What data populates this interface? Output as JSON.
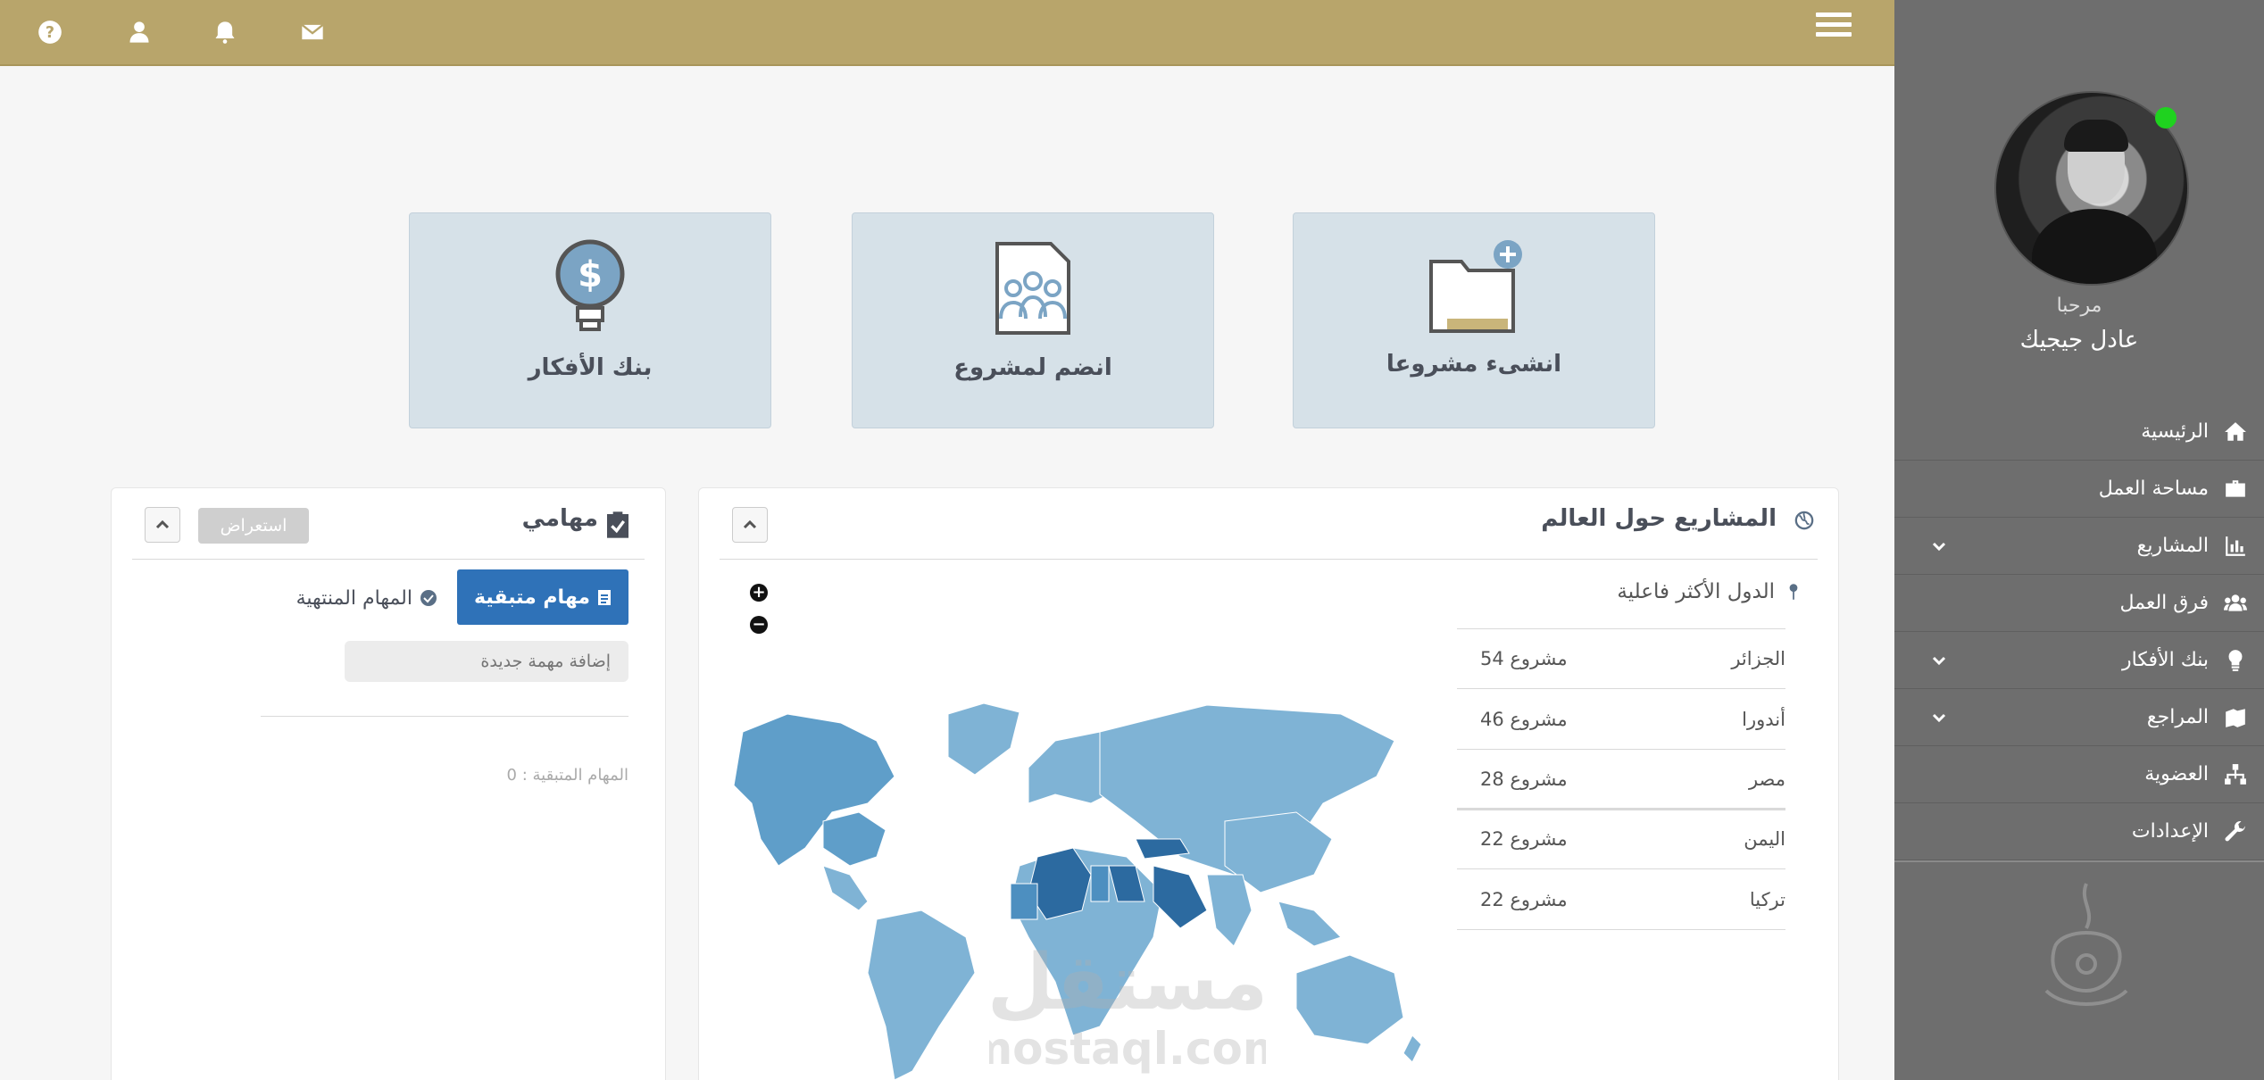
{
  "topbar": {
    "icons": [
      "help-icon",
      "user-icon",
      "bell-icon",
      "envelope-icon"
    ],
    "menu_icon": "hamburger-icon",
    "color": "#b8a56b"
  },
  "sidebar": {
    "greeting": "مرحبا",
    "username": "عادل جيجيك",
    "online_color": "#1fd21f",
    "items": [
      {
        "label": "الرئيسية",
        "icon": "home-icon",
        "has_submenu": false
      },
      {
        "label": "مساحة العمل",
        "icon": "briefcase-icon",
        "has_submenu": false
      },
      {
        "label": "المشاريع",
        "icon": "chart-icon",
        "has_submenu": true
      },
      {
        "label": "فرق العمل",
        "icon": "users-icon",
        "has_submenu": false
      },
      {
        "label": "بنك الأفكار",
        "icon": "lightbulb-icon",
        "has_submenu": true
      },
      {
        "label": "المراجع",
        "icon": "books-icon",
        "has_submenu": true
      },
      {
        "label": "العضوية",
        "icon": "sitemap-icon",
        "has_submenu": false
      },
      {
        "label": "الإعدادات",
        "icon": "wrench-icon",
        "has_submenu": false
      }
    ]
  },
  "cards": {
    "create": "انشىء مشروعا",
    "join": "انضم لمشروع",
    "ideas": "بنك الأفكار"
  },
  "projects_panel": {
    "title": "المشاريع حول العالم",
    "top_countries_title": "الدول الأكثر فاعلية",
    "countries": [
      {
        "name": "الجزائر",
        "count": "54 مشروع"
      },
      {
        "name": "أندورا",
        "count": "46 مشروع"
      },
      {
        "name": "مصر",
        "count": "28 مشروع"
      },
      {
        "name": "اليمن",
        "count": "22 مشروع"
      },
      {
        "name": "تركيا",
        "count": "22 مشروع"
      }
    ],
    "zoom_in": "+",
    "zoom_out": "−"
  },
  "tasks_panel": {
    "title": "مهامي",
    "browse_label": "استعراض",
    "pending_tab": "مهام متبقية",
    "done_tab": "المهام المنتهية",
    "new_task_placeholder": "إضافة مهمة جديدة",
    "pending_count": "المهام المتبقية : 0"
  },
  "watermark": {
    "text_ar": "مستقل",
    "text_en": "mostaql.com"
  },
  "colors": {
    "card_bg": "#d6e1e8",
    "primary_button": "#2f72b8",
    "map_light": "#7fb3d5",
    "map_dark": "#2c6aa0"
  }
}
